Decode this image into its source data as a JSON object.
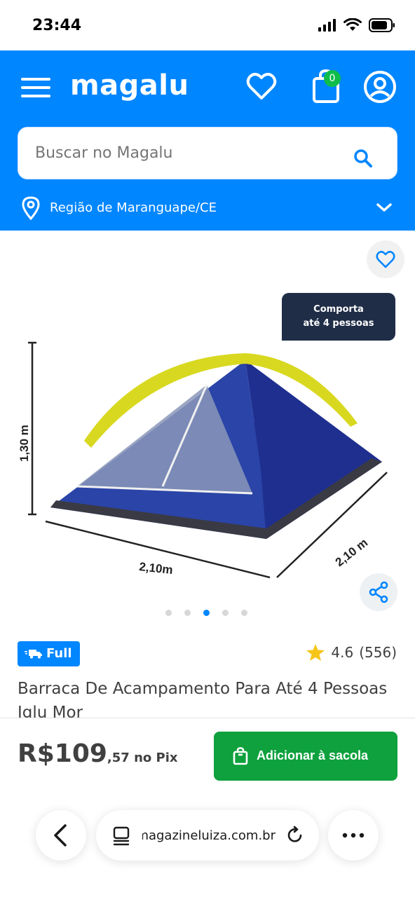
{
  "status_bar": {
    "time": "23:44"
  },
  "header": {
    "brand": "magalu",
    "cart_count": "0",
    "search_placeholder": "Buscar no Magalu",
    "location": "Região de Maranguape/CE"
  },
  "gallery": {
    "badge_line1": "Comporta",
    "badge_line2": "até 4 pessoas",
    "dim_height": "1,30 m",
    "dim_width": "2,10m",
    "dim_depth": "2,10 m",
    "dot_count": 5,
    "active_dot": 3
  },
  "product": {
    "shipping_badge": "Full",
    "rating": "4.6",
    "reviews": "(556)",
    "title": "Barraca De Acampamento Para Até 4 Pessoas Iglu Mor"
  },
  "buy_bar": {
    "price_main": "R$109",
    "price_cents": ",57",
    "price_suffix": " no Pix",
    "add_button": "Adicionar à sacola"
  },
  "browser": {
    "url": "magazineluiza.com.br"
  },
  "colors": {
    "brand_blue": "#0086ff",
    "buy_green": "#0ea13d",
    "badge_green": "#0ebd49",
    "star": "#f5c518"
  }
}
